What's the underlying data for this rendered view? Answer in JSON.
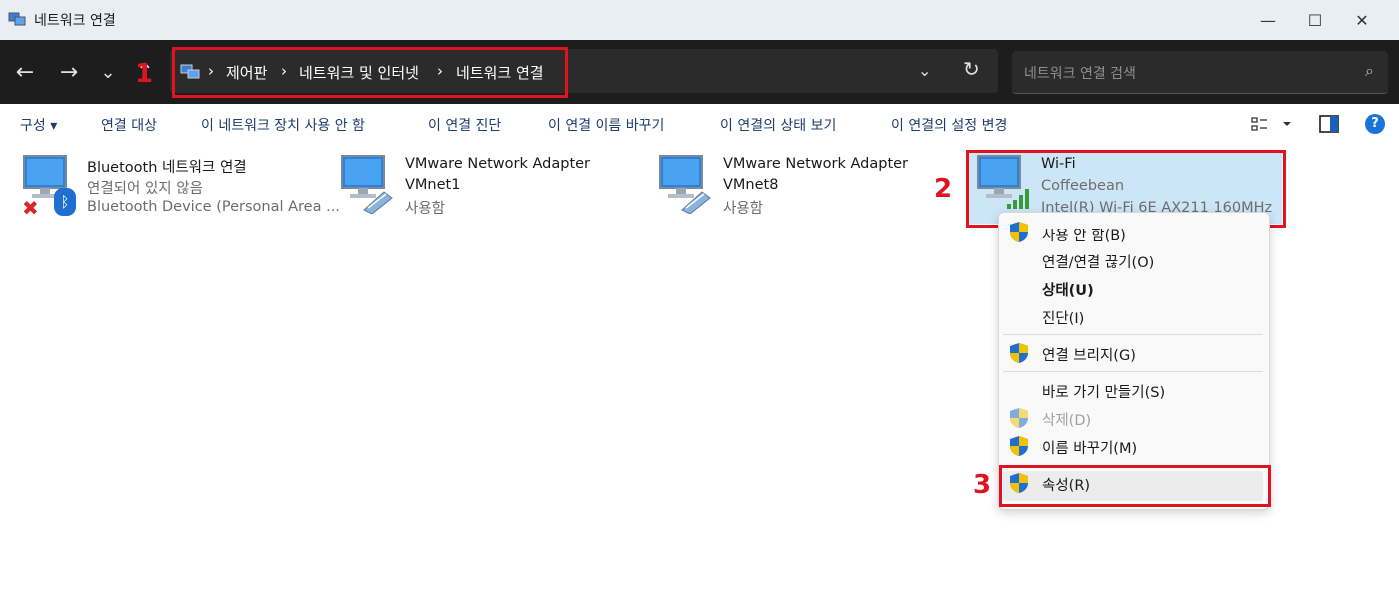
{
  "window": {
    "title": "네트워크 연결",
    "minimize": "—",
    "maximize": "☐",
    "close": "✕"
  },
  "nav": {
    "back": "←",
    "forward": "→",
    "recent": "⌄",
    "up": "↑"
  },
  "address": {
    "crumbs": [
      "제어판",
      "네트워크 및 인터넷",
      "네트워크 연결"
    ],
    "separator": "›",
    "dropdown": "⌄",
    "refresh": "↻"
  },
  "search": {
    "placeholder": "네트워크 연결 검색",
    "icon": "search-icon"
  },
  "commands": {
    "organize": "구성 ▾",
    "connect_to": "연결 대상",
    "disable": "이 네트워크 장치 사용 안 함",
    "diagnose": "이 연결 진단",
    "rename": "이 연결 이름 바꾸기",
    "status": "이 연결의 상태 보기",
    "settings": "이 연결의 설정 변경",
    "view_icon": "view-options-icon",
    "pane_icon": "preview-pane-icon",
    "help": "?"
  },
  "adapters": [
    {
      "name": "Bluetooth 네트워크 연결",
      "line2": "연결되어 있지 않음",
      "line3": "Bluetooth Device (Personal Area ..."
    },
    {
      "name": "VMware Network Adapter",
      "line2": "VMnet1",
      "line3": "사용함"
    },
    {
      "name": "VMware Network Adapter",
      "line2": "VMnet8",
      "line3": "사용함"
    },
    {
      "name": "Wi-Fi",
      "line2": "Coffeebean",
      "line3": "Intel(R) Wi-Fi 6E AX211 160MHz"
    }
  ],
  "context_menu": {
    "items": [
      {
        "label": "사용 안 함(B)",
        "shield": true
      },
      {
        "label": "연결/연결 끊기(O)",
        "shield": false
      },
      {
        "label": "상태(U)",
        "shield": false,
        "bold": true
      },
      {
        "label": "진단(I)",
        "shield": false
      },
      {
        "label": "연결 브리지(G)",
        "shield": true
      },
      {
        "label": "바로 가기 만들기(S)",
        "shield": false
      },
      {
        "label": "삭제(D)",
        "shield": true,
        "disabled": true
      },
      {
        "label": "이름 바꾸기(M)",
        "shield": true
      },
      {
        "label": "속성(R)",
        "shield": true
      }
    ]
  },
  "annotations": {
    "n1": "1",
    "n2": "2",
    "n3": "3"
  },
  "colors": {
    "annotation_red": "#e0141e",
    "selection": "#cde6f7",
    "dark_bar": "#1d1d1d"
  }
}
